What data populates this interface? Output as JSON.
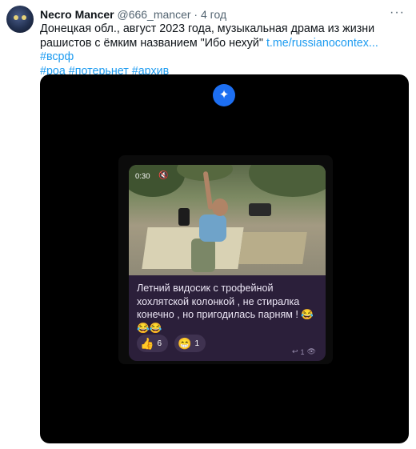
{
  "tweet": {
    "display_name": "Necro Mancer",
    "handle": "@666_mancer",
    "separator": "·",
    "time": "4 год",
    "more_icon": "more-horizontal-icon",
    "text_line1": "Донецкая обл., август 2023 года, музыкальная драма из жизни",
    "text_line2_prefix": "рашистов с ёмким названием \"Ибо нехуй\" ",
    "link": "t.me/russianocontex...",
    "hashtags_line2": "#всрф",
    "hashtags_line3": [
      "#роа",
      "#потерьнет",
      "#архив"
    ]
  },
  "media": {
    "ai_badge_icon": "sparkle-icon",
    "ai_badge_glyph": "✦",
    "video": {
      "timecode": "0:30",
      "volume_icon": "muted-speaker-icon",
      "volume_glyph": "🔇"
    },
    "message": {
      "caption": "Летний видосик с трофейной хохлятской колонкой ,  не стиралка конечно , но пригодилась парням ! 😂😂😂",
      "reactions": [
        {
          "emoji": "👍",
          "count": "6"
        },
        {
          "emoji": "😁",
          "count": "1"
        }
      ],
      "reply_icon": "reply-arrow-icon",
      "reply_glyph": "↩",
      "reply_count": "1",
      "views_icon": "eye-icon",
      "views_glyph": "👁"
    }
  },
  "colors": {
    "link": "#1d9bf0",
    "text": "#0f1419",
    "muted": "#536471",
    "message_bubble": "#2b1f3a",
    "ai_badge": "#1d6ff2"
  }
}
